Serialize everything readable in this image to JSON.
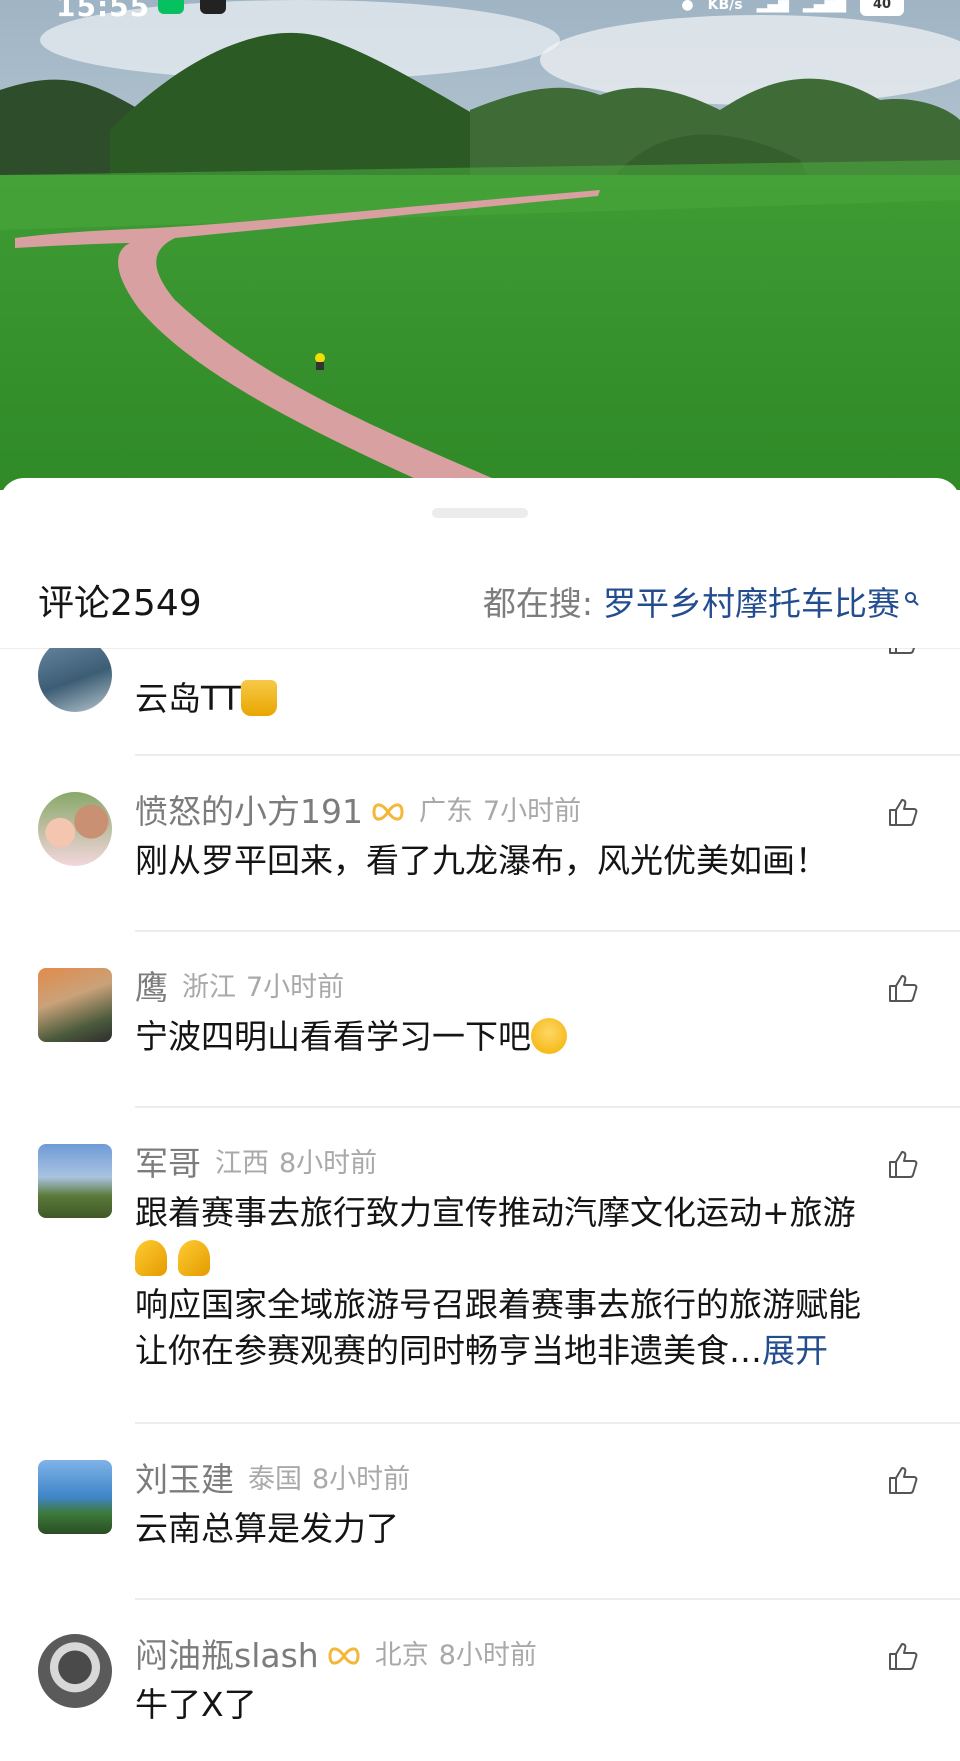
{
  "status_bar": {
    "time": "15:55",
    "network_unit": "KB/s",
    "battery": "40"
  },
  "comments_panel": {
    "title": "评论",
    "count": "2549",
    "trending_label": "都在搜:",
    "trending_query": "罗平乡村摩托车比赛"
  },
  "comments": [
    {
      "username": "",
      "location": "",
      "time": "",
      "text": "云岛TT",
      "emoji": [
        "thumbs-up"
      ]
    },
    {
      "username": "愤怒的小方191",
      "badge": "vip-badge",
      "location": "广东",
      "time": "7小时前",
      "text": "刚从罗平回来，看了九龙瀑布，风光优美如画！"
    },
    {
      "username": "鹰",
      "location": "浙江",
      "time": "7小时前",
      "text": "宁波四明山看看学习一下吧",
      "emoji": [
        "grinning-face"
      ]
    },
    {
      "username": "军哥",
      "location": "江西",
      "time": "8小时前",
      "text_line1": "跟着赛事去旅行致力宣传推动汽摩文化运动+旅游",
      "emoji": [
        "folded-hands",
        "folded-hands"
      ],
      "text_line2": "响应国家全域旅游号召跟着赛事去旅行的旅游赋能",
      "text_line3": "让你在参赛观赛的同时畅亨当地非遗美食…",
      "expand_label": "展开"
    },
    {
      "username": "刘玉建",
      "location": "泰国",
      "time": "8小时前",
      "text": "云南总算是发力了"
    },
    {
      "username": "闷油瓶slash",
      "badge": "vip-badge",
      "location": "北京",
      "time": "8小时前",
      "text": "牛了X了"
    }
  ],
  "colors": {
    "accent_link": "#244d8f",
    "meta_gray": "#a9a9a9",
    "name_gray": "#7c7c7c",
    "badge_gold": "#f4b73a"
  }
}
